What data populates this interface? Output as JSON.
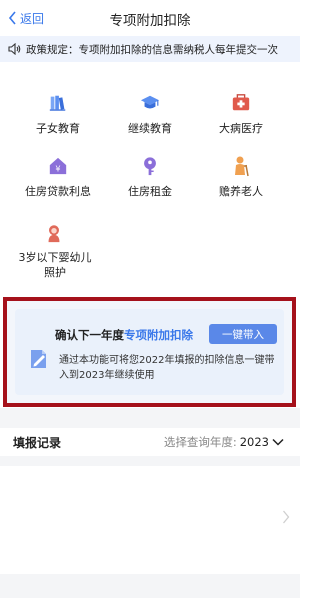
{
  "nav": {
    "back_label": "返回",
    "title": "专项附加扣除"
  },
  "notice": {
    "text": "政策规定：专项附加扣除的信息需纳税人每年提交一次"
  },
  "deductions": [
    {
      "label": "子女教育",
      "icon": "books-icon",
      "color": "#5b8ff0"
    },
    {
      "label": "继续教育",
      "icon": "graduation-cap-icon",
      "color": "#5b8ff0"
    },
    {
      "label": "大病医疗",
      "icon": "medical-kit-icon",
      "color": "#e05a4c"
    },
    {
      "label": "住房贷款利息",
      "icon": "house-yen-icon",
      "color": "#8b6fd9"
    },
    {
      "label": "住房租金",
      "icon": "key-icon",
      "color": "#8b6fd9"
    },
    {
      "label": "赡养老人",
      "icon": "elderly-icon",
      "color": "#f0a050"
    },
    {
      "label": "3岁以下婴幼儿照护",
      "icon": "baby-icon",
      "color": "#e06a5a"
    }
  ],
  "carry_card": {
    "title_prefix": "确认下一年度",
    "title_highlight": "专项附加扣除",
    "button_label": "一键带入",
    "description": "通过本功能可将您2022年填报的扣除信息一键带入到2023年继续使用",
    "icon": "document-edit-icon",
    "accent": "#3a78ea",
    "highlight_border": "#a5111b"
  },
  "records": {
    "title": "填报记录",
    "filter_label": "选择查询年度:",
    "year": "2023"
  }
}
